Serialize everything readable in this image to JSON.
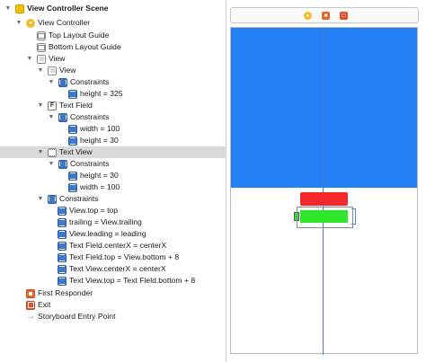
{
  "outline": {
    "rows": [
      {
        "key": "scene",
        "label": "View Controller Scene",
        "icon": "scene-icon",
        "expanded": true,
        "selected": false
      },
      {
        "key": "vc",
        "label": "View Controller",
        "icon": "view-controller-icon",
        "expanded": true,
        "selected": false
      },
      {
        "key": "top_guide",
        "label": "Top Layout Guide",
        "icon": "layout-guide-icon",
        "expanded": false,
        "selected": false
      },
      {
        "key": "bottom_guide",
        "label": "Bottom Layout Guide",
        "icon": "layout-guide-icon",
        "expanded": false,
        "selected": false
      },
      {
        "key": "root_view",
        "label": "View",
        "icon": "view-icon",
        "expanded": true,
        "selected": false
      },
      {
        "key": "inner_view",
        "label": "View",
        "icon": "view-icon",
        "expanded": true,
        "selected": false
      },
      {
        "key": "inner_constraints",
        "label": "Constraints",
        "icon": "constraints-icon",
        "expanded": true,
        "selected": false
      },
      {
        "key": "inner_height",
        "label": "height = 325",
        "icon": "measure-constraint-icon",
        "selected": false
      },
      {
        "key": "text_field",
        "label": "Text Field",
        "icon": "text-field-icon",
        "expanded": true,
        "selected": false
      },
      {
        "key": "tf_constraints",
        "label": "Constraints",
        "icon": "constraints-icon",
        "expanded": true,
        "selected": false
      },
      {
        "key": "tf_width",
        "label": "width = 100",
        "icon": "measure-constraint-icon",
        "selected": false
      },
      {
        "key": "tf_height",
        "label": "height = 30",
        "icon": "measure-constraint-icon",
        "selected": false
      },
      {
        "key": "text_view",
        "label": "Text View",
        "icon": "text-view-icon",
        "expanded": true,
        "selected": true
      },
      {
        "key": "tv_constraints",
        "label": "Constraints",
        "icon": "constraints-icon",
        "expanded": true,
        "selected": false
      },
      {
        "key": "tv_height",
        "label": "height = 30",
        "icon": "measure-constraint-icon",
        "selected": false
      },
      {
        "key": "tv_width",
        "label": "width = 100",
        "icon": "measure-constraint-icon",
        "selected": false
      },
      {
        "key": "root_constraints",
        "label": "Constraints",
        "icon": "constraints-icon",
        "expanded": true,
        "selected": false
      },
      {
        "key": "c1",
        "label": "View.top = top",
        "icon": "measure-constraint-icon",
        "selected": false
      },
      {
        "key": "c2",
        "label": "trailing = View.trailing",
        "icon": "measure-constraint-icon",
        "selected": false
      },
      {
        "key": "c3",
        "label": "View.leading = leading",
        "icon": "measure-constraint-icon",
        "selected": false
      },
      {
        "key": "c4",
        "label": "Text Field.centerX = centerX",
        "icon": "measure-constraint-icon",
        "selected": false
      },
      {
        "key": "c5",
        "label": "Text Field.top = View.bottom + 8",
        "icon": "measure-constraint-icon",
        "selected": false
      },
      {
        "key": "c6",
        "label": "Text View.centerX = centerX",
        "icon": "measure-constraint-icon",
        "selected": false
      },
      {
        "key": "c7",
        "label": "Text View.top = Text Field.bottom + 8",
        "icon": "measure-constraint-icon",
        "selected": false
      },
      {
        "key": "first_responder",
        "label": "First Responder",
        "icon": "first-responder-icon",
        "selected": false
      },
      {
        "key": "exit",
        "label": "Exit",
        "icon": "exit-icon",
        "selected": false
      },
      {
        "key": "entry",
        "label": "Storyboard Entry Point",
        "icon": "entry-arrow-icon",
        "selected": false
      }
    ]
  },
  "canvas": {
    "scene_bar_icons": [
      "view-controller-icon",
      "first-responder-icon",
      "exit-icon"
    ],
    "colors": {
      "top_view": "#2280f2",
      "text_field": "#f2282a",
      "text_view": "#2ee62a",
      "selection": "#dadada"
    }
  }
}
